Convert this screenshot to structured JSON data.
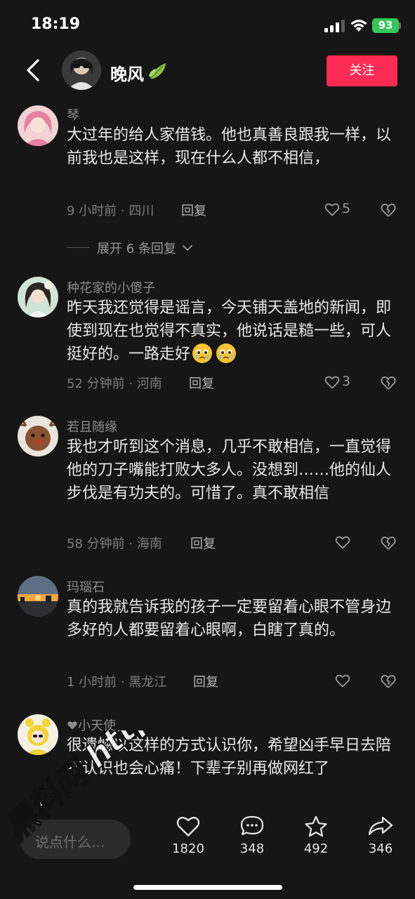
{
  "status_bar": {
    "time": "18:19",
    "battery": "93"
  },
  "header": {
    "name": "晚风",
    "follow_label": "关注"
  },
  "comments": [
    {
      "username": "琴",
      "text": "大过年的给人家借钱。他也真善良跟我一样，以前我也是这样，现在什么人都不相信，",
      "meta": "9 小时前 · 四川",
      "reply_label": "回复",
      "likes": "5"
    },
    {
      "username": "种花家的小傻子",
      "text": "昨天我还觉得是谣言，今天铺天盖地的新闻，即使到现在也觉得不真实，他说话是糙一些，可人挺好的。一路走好",
      "meta": "52 分钟前 · 河南",
      "reply_label": "回复",
      "likes": "3"
    },
    {
      "username": "若且随缘",
      "text": "我也才听到这个消息，几乎不敢相信，一直觉得他的刀子嘴能打败大多人。没想到……他的仙人步伐是有功夫的。可惜了。真不敢相信",
      "meta": "58 分钟前 · 海南",
      "reply_label": "回复",
      "likes": ""
    },
    {
      "username": "玛瑙石",
      "text": "真的我就告诉我的孩子一定要留着心眼不管身边多好的人都要留着心眼啊，白瞎了真的。",
      "meta": "1 小时前 · 黑龙江",
      "reply_label": "回复",
      "likes": ""
    },
    {
      "username": "小天使",
      "text": "很遗憾以这样的方式认识你，希望凶手早日去陪 不认识也会心痛！下辈子别再做网红了",
      "meta": "",
      "reply_label": "",
      "likes": ""
    }
  ],
  "expand_replies": "展开 6 条回复",
  "bottom_bar": {
    "input_placeholder": "说点什么...",
    "likes": "1820",
    "comments": "348",
    "favorites": "492",
    "shares": "346"
  },
  "watermark": "黑料网 https://hl15.co"
}
